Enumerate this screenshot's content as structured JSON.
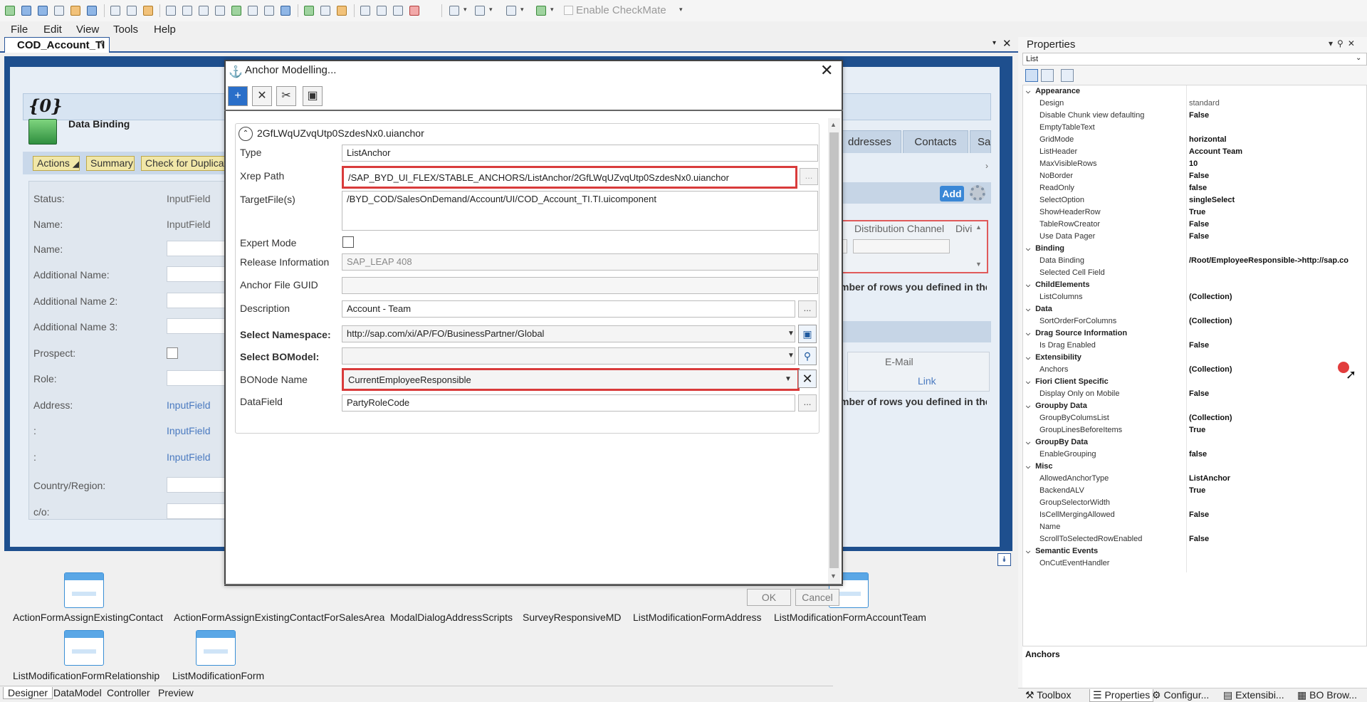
{
  "toolbar": {
    "checkmate_label": "Enable CheckMate"
  },
  "menu": [
    "File",
    "Edit",
    "View",
    "Tools",
    "Help"
  ],
  "document_tab": "COD_Account_TI",
  "designer": {
    "title_placeholder": "{0}",
    "section_title": "Data Binding",
    "actions": [
      "Actions",
      "Summary",
      "Check for Duplicat"
    ],
    "form_fields": [
      {
        "label": "Status:",
        "type": "InputField"
      },
      {
        "label": "Name:",
        "type": "InputField"
      },
      {
        "label": "Name:"
      },
      {
        "label": "Additional Name:"
      },
      {
        "label": "Additional Name 2:"
      },
      {
        "label": "Additional Name 3:"
      },
      {
        "label": "Prospect:"
      },
      {
        "label": "Role:"
      },
      {
        "label": "Address:",
        "type": "InputField"
      },
      {
        "label": ":",
        "type": "InputField"
      },
      {
        "label": ":",
        "type": "InputField"
      },
      {
        "label": "Country/Region:"
      },
      {
        "label": "c/o:"
      }
    ],
    "right_tabs": [
      "ddresses",
      "Contacts",
      "Sal"
    ],
    "add_label": "Add",
    "table1_headers": [
      "Distribution Channel",
      "Divi"
    ],
    "hint_text": "mber of rows you defined in the",
    "table2_headers": [
      "E-Mail"
    ],
    "table2_links": [
      "k",
      "Link"
    ]
  },
  "templates": [
    "ActionFormAssignExistingContact",
    "ActionFormAssignExistingContactForSalesArea",
    "ModalDialogAddressScripts",
    "SurveyResponsiveMD",
    "ListModificationFormAddress",
    "ListModificationFormAccountTeam",
    "ListModificationFormRelationship",
    "ListModificationForm"
  ],
  "bottom_tabs": [
    "Designer",
    "DataModel",
    "Controller",
    "Preview"
  ],
  "properties": {
    "title": "Properties",
    "selected_object": "List",
    "description_title": "Anchors",
    "categories": [
      {
        "name": "Appearance",
        "rows": [
          {
            "key": "Design",
            "value": "standard",
            "plain": true
          },
          {
            "key": "Disable Chunk view defaulting",
            "value": "False"
          },
          {
            "key": "EmptyTableText",
            "value": ""
          },
          {
            "key": "GridMode",
            "value": "horizontal"
          },
          {
            "key": "ListHeader",
            "value": "Account Team"
          },
          {
            "key": "MaxVisibleRows",
            "value": "10"
          },
          {
            "key": "NoBorder",
            "value": "False"
          },
          {
            "key": "ReadOnly",
            "value": "false"
          },
          {
            "key": "SelectOption",
            "value": "singleSelect"
          },
          {
            "key": "ShowHeaderRow",
            "value": "True"
          },
          {
            "key": "TableRowCreator",
            "value": "False"
          },
          {
            "key": "Use Data Pager",
            "value": "False"
          }
        ]
      },
      {
        "name": "Binding",
        "rows": [
          {
            "key": "Data Binding",
            "value": "/Root/EmployeeResponsible->http://sap.co"
          },
          {
            "key": "Selected Cell Field",
            "value": ""
          }
        ]
      },
      {
        "name": "ChildElements",
        "rows": [
          {
            "key": "ListColumns",
            "value": "(Collection)"
          }
        ]
      },
      {
        "name": "Data",
        "rows": [
          {
            "key": "SortOrderForColumns",
            "value": "(Collection)"
          }
        ]
      },
      {
        "name": "Drag Source Information",
        "rows": [
          {
            "key": "Is Drag Enabled",
            "value": "False"
          }
        ]
      },
      {
        "name": "Extensibility",
        "rows": [
          {
            "key": "Anchors",
            "value": "(Collection)"
          }
        ]
      },
      {
        "name": "Fiori Client Specific",
        "rows": [
          {
            "key": "Display Only on Mobile",
            "value": "False"
          }
        ]
      },
      {
        "name": "Groupby Data",
        "rows": [
          {
            "key": "GroupByColumsList",
            "value": "(Collection)"
          },
          {
            "key": "GroupLinesBeforeItems",
            "value": "True"
          }
        ]
      },
      {
        "name": "GroupBy Data",
        "rows": [
          {
            "key": "EnableGrouping",
            "value": "false"
          }
        ]
      },
      {
        "name": "Misc",
        "rows": [
          {
            "key": "AllowedAnchorType",
            "value": "ListAnchor"
          },
          {
            "key": "BackendALV",
            "value": "True"
          },
          {
            "key": "GroupSelectorWidth",
            "value": ""
          },
          {
            "key": "IsCellMergingAllowed",
            "value": "False"
          },
          {
            "key": "Name",
            "value": ""
          },
          {
            "key": "ScrollToSelectedRowEnabled",
            "value": "False"
          }
        ]
      },
      {
        "name": "Semantic Events",
        "rows": [
          {
            "key": "OnCutEventHandler",
            "value": ""
          }
        ]
      }
    ],
    "bottom_tabs": [
      "Toolbox",
      "Properties",
      "Configur...",
      "Extensibi...",
      "BO Brow..."
    ]
  },
  "dialog": {
    "title": "Anchor Modelling...",
    "anchor_name": "2GfLWqUZvqUtp0SzdesNx0.uianchor",
    "fields": {
      "type_label": "Type",
      "type_value": "ListAnchor",
      "xrep_label": "Xrep Path",
      "xrep_value": "/SAP_BYD_UI_FLEX/STABLE_ANCHORS/ListAnchor/2GfLWqUZvqUtp0SzdesNx0.uianchor",
      "target_label": "TargetFile(s)",
      "target_value": "/BYD_COD/SalesOnDemand/Account/UI/COD_Account_TI.TI.uicomponent",
      "expert_label": "Expert Mode",
      "release_label": "Release Information",
      "release_value": "SAP_LEAP 408",
      "guid_label": "Anchor File GUID",
      "guid_value": "",
      "desc_label": "Description",
      "desc_value": "Account - Team",
      "ns_label": "Select Namespace:",
      "ns_value": "http://sap.com/xi/AP/FO/BusinessPartner/Global",
      "bo_label": "Select BOModel:",
      "bo_value": "",
      "bonode_label": "BONode Name",
      "bonode_value": "CurrentEmployeeResponsible",
      "datafield_label": "DataField",
      "datafield_value": "PartyRoleCode"
    },
    "ok_label": "OK",
    "cancel_label": "Cancel"
  }
}
